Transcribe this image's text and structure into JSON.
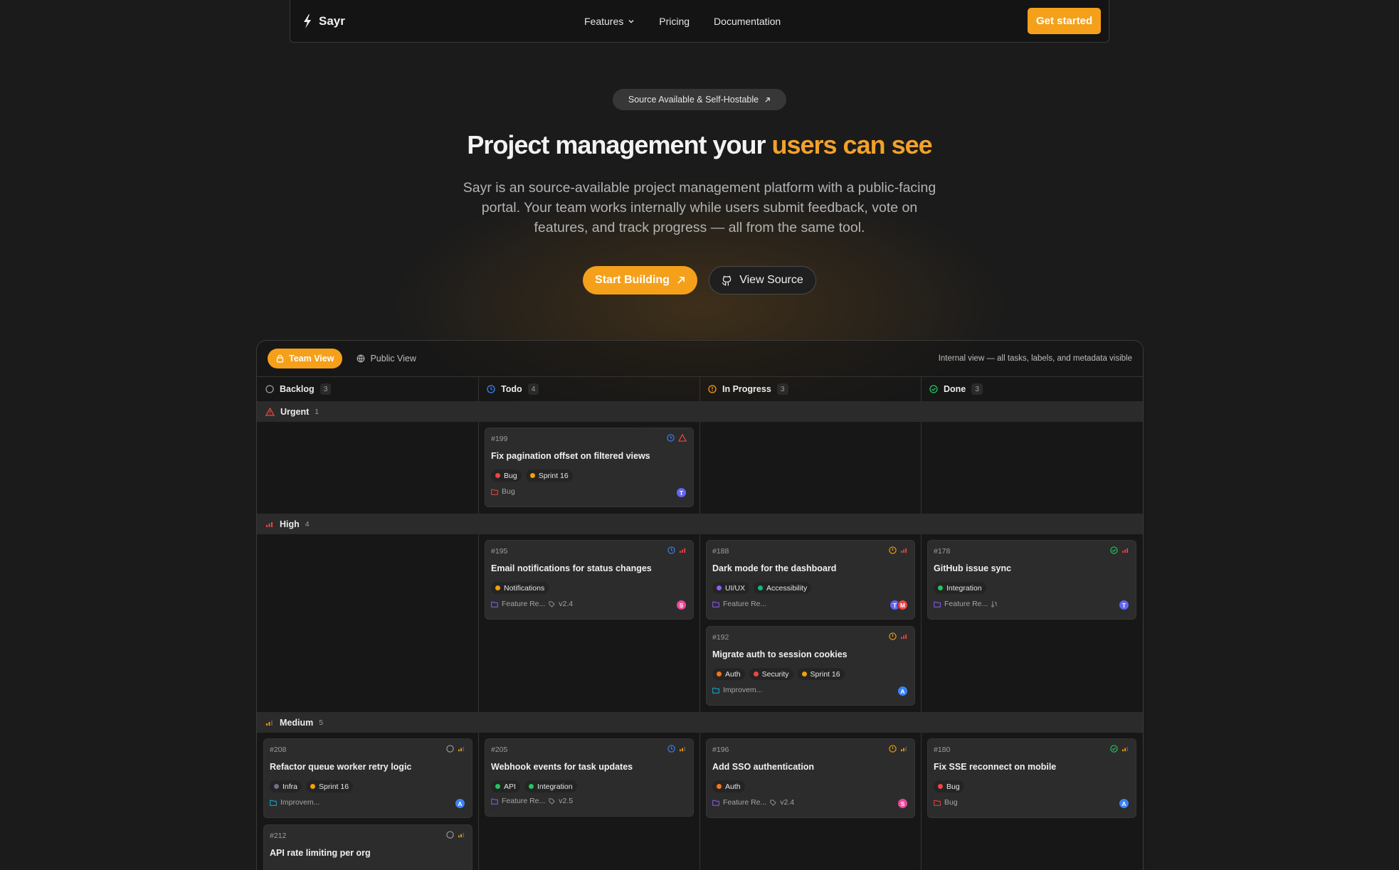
{
  "nav": {
    "brand": "Sayr",
    "links": [
      "Features",
      "Pricing",
      "Documentation"
    ],
    "cta": "Get started"
  },
  "hero": {
    "pill": "Source Available & Self-Hostable",
    "title_main": "Project management your ",
    "title_accent": "users can see",
    "subtitle": "Sayr is an source-available project management platform with a public-facing portal. Your team works internally while users submit feedback, vote on features, and track progress — all from the same tool.",
    "primary_button": "Start Building",
    "secondary_button": "View Source"
  },
  "board": {
    "tabs": {
      "team": "Team View",
      "public": "Public View"
    },
    "note": "Internal view — all tasks, labels, and metadata visible",
    "columns": [
      {
        "name": "Backlog",
        "count": "3"
      },
      {
        "name": "Todo",
        "count": "4"
      },
      {
        "name": "In Progress",
        "count": "3"
      },
      {
        "name": "Done",
        "count": "3"
      }
    ],
    "groups": [
      {
        "name": "Urgent",
        "count": "1"
      },
      {
        "name": "High",
        "count": "4"
      },
      {
        "name": "Medium",
        "count": "5"
      }
    ],
    "cards": [
      {
        "id": "#199",
        "title": "Fix pagination offset on filtered views",
        "tags": [
          {
            "label": "Bug",
            "color": "#ef4444"
          },
          {
            "label": "Sprint 16",
            "color": "#f59e0b"
          }
        ],
        "category": "Bug",
        "version": "",
        "avatars": [
          "T"
        ]
      },
      {
        "id": "#195",
        "title": "Email notifications for status changes",
        "tags": [
          {
            "label": "Notifications",
            "color": "#f59e0b"
          }
        ],
        "category": "Feature Re...",
        "version": "v2.4",
        "avatars": [
          "S"
        ]
      },
      {
        "id": "#188",
        "title": "Dark mode for the dashboard",
        "tags": [
          {
            "label": "UI/UX",
            "color": "#8b5cf6"
          },
          {
            "label": "Accessibility",
            "color": "#10b981"
          }
        ],
        "category": "Feature Re...",
        "version": "",
        "avatars": [
          "T",
          "M"
        ]
      },
      {
        "id": "#192",
        "title": "Migrate auth to session cookies",
        "tags": [
          {
            "label": "Auth",
            "color": "#f97316"
          },
          {
            "label": "Security",
            "color": "#ef4444"
          },
          {
            "label": "Sprint 16",
            "color": "#f59e0b"
          }
        ],
        "category": "Improvem...",
        "version": "",
        "avatars": [
          "A"
        ]
      },
      {
        "id": "#178",
        "title": "GitHub issue sync",
        "tags": [
          {
            "label": "Integration",
            "color": "#22c55e"
          }
        ],
        "category": "Feature Re...",
        "version": "",
        "avatars": [
          "T"
        ]
      },
      {
        "id": "#208",
        "title": "Refactor queue worker retry logic",
        "tags": [
          {
            "label": "Infra",
            "color": "#6b7280"
          },
          {
            "label": "Sprint 16",
            "color": "#f59e0b"
          }
        ],
        "category": "Improvem...",
        "version": "",
        "avatars": [
          "A"
        ]
      },
      {
        "id": "#205",
        "title": "Webhook events for task updates",
        "tags": [
          {
            "label": "API",
            "color": "#22c55e"
          },
          {
            "label": "Integration",
            "color": "#22c55e"
          }
        ],
        "category": "Feature Re...",
        "version": "v2.5",
        "avatars": []
      },
      {
        "id": "#196",
        "title": "Add SSO authentication",
        "tags": [
          {
            "label": "Auth",
            "color": "#f97316"
          }
        ],
        "category": "Feature Re...",
        "version": "v2.4",
        "avatars": [
          "S"
        ]
      },
      {
        "id": "#180",
        "title": "Fix SSE reconnect on mobile",
        "tags": [
          {
            "label": "Bug",
            "color": "#ef4444"
          }
        ],
        "category": "Bug",
        "version": "",
        "avatars": [
          "A"
        ]
      },
      {
        "id": "#212",
        "title": "API rate limiting per org",
        "tags": [],
        "category": "",
        "version": "",
        "avatars": []
      }
    ]
  },
  "colors": {
    "accent": "#f5a01b",
    "avatar_T": "#6366f1",
    "avatar_S": "#ec4899",
    "avatar_M": "#ef4444",
    "avatar_A": "#3b82f6"
  }
}
